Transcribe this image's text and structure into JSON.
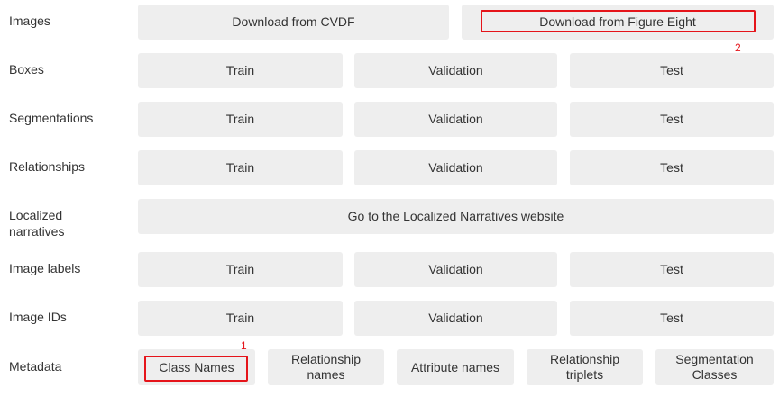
{
  "rows": {
    "images": {
      "label": "Images",
      "cvdf": "Download from CVDF",
      "figure_eight": "Download from Figure Eight"
    },
    "boxes": {
      "label": "Boxes",
      "train": "Train",
      "validation": "Validation",
      "test": "Test"
    },
    "segmentations": {
      "label": "Segmentations",
      "train": "Train",
      "validation": "Validation",
      "test": "Test"
    },
    "relationships": {
      "label": "Relationships",
      "train": "Train",
      "validation": "Validation",
      "test": "Test"
    },
    "localized_narratives": {
      "label_line1": "Localized",
      "label_line2": "narratives",
      "website": "Go to the Localized Narratives website"
    },
    "image_labels": {
      "label": "Image labels",
      "train": "Train",
      "validation": "Validation",
      "test": "Test"
    },
    "image_ids": {
      "label": "Image IDs",
      "train": "Train",
      "validation": "Validation",
      "test": "Test"
    },
    "metadata": {
      "label": "Metadata",
      "class_names": "Class Names",
      "relationship_names_line1": "Relationship",
      "relationship_names_line2": "names",
      "attribute_names": "Attribute names",
      "relationship_triplets_line1": "Relationship",
      "relationship_triplets_line2": "triplets",
      "segmentation_classes_line1": "Segmentation",
      "segmentation_classes_line2": "Classes"
    }
  },
  "annotations": {
    "marker_1": "1",
    "marker_2": "2",
    "color": "#e5141a"
  },
  "colors": {
    "button_bg": "#eeeeee",
    "text": "#333333"
  }
}
